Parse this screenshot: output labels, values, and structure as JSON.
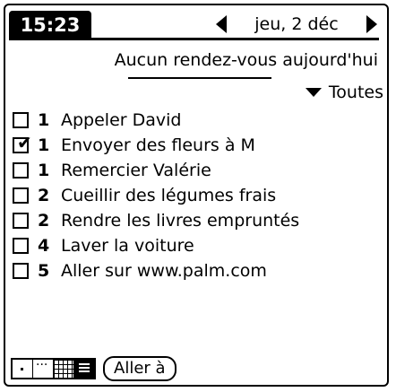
{
  "header": {
    "time": "15:23",
    "date": "jeu, 2 déc",
    "prev_icon": "left-triangle-icon",
    "next_icon": "right-triangle-icon"
  },
  "appointments": {
    "summary": "Aucun rendez-vous aujourd'hui"
  },
  "filter": {
    "label": "Toutes",
    "icon": "dropdown-triangle-icon"
  },
  "todos": [
    {
      "priority": "1",
      "text": "Appeler David",
      "checked": false
    },
    {
      "priority": "1",
      "text": "Envoyer des fleurs à M",
      "checked": true
    },
    {
      "priority": "1",
      "text": "Remercier Valérie",
      "checked": false
    },
    {
      "priority": "2",
      "text": "Cueillir des légumes frais",
      "checked": false
    },
    {
      "priority": "2",
      "text": "Rendre les livres empruntés",
      "checked": false
    },
    {
      "priority": "4",
      "text": "Laver la voiture",
      "checked": false
    },
    {
      "priority": "5",
      "text": "Aller sur www.palm.com",
      "checked": false
    }
  ],
  "toolbar": {
    "views": [
      "day-view-icon",
      "week-view-icon",
      "month-view-icon",
      "list-view-icon"
    ],
    "selected_view": "list-view-icon",
    "goto_label": "Aller à"
  }
}
